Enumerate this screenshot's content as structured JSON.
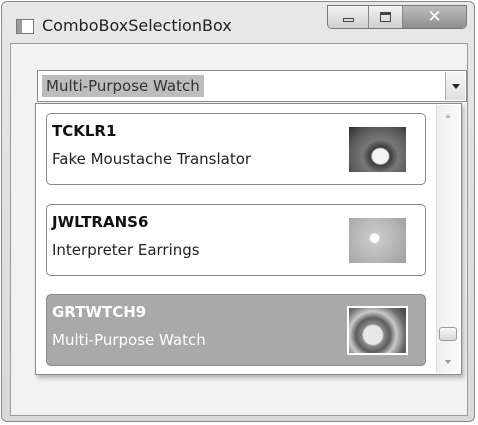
{
  "window": {
    "title": "ComboBoxSelectionBox",
    "close_glyph": "✕"
  },
  "combo": {
    "selected_text": "Multi-Purpose Watch"
  },
  "items": [
    {
      "code": "TCKLR1",
      "name": "Fake Moustache Translator",
      "thumb_icon": "moustache-photo",
      "selected": false
    },
    {
      "code": "JWLTRANS6",
      "name": "Interpreter Earrings",
      "thumb_icon": "earring-photo",
      "selected": false
    },
    {
      "code": "GRTWTCH9",
      "name": "Multi-Purpose Watch",
      "thumb_icon": "watch-photo",
      "selected": true
    }
  ],
  "colors": {
    "selected_item_bg": "#a9a9a9",
    "selected_text_highlight": "#bdbdbd"
  }
}
